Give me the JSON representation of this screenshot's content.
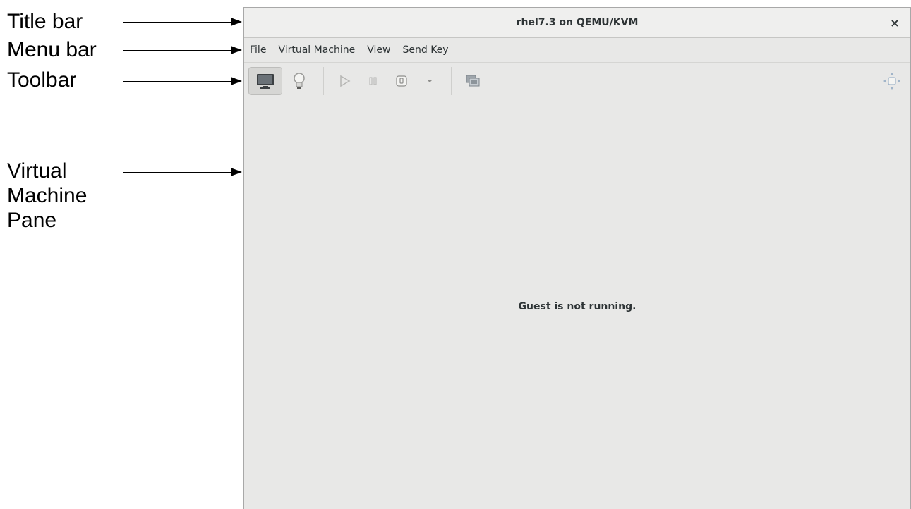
{
  "annotations": {
    "title_bar": "Title bar",
    "menu_bar": "Menu bar",
    "toolbar": "Toolbar",
    "vm_pane_line1": "Virtual",
    "vm_pane_line2": "Machine",
    "vm_pane_line3": "Pane"
  },
  "window": {
    "title": "rhel7.3 on QEMU/KVM",
    "close_glyph": "×"
  },
  "menubar": {
    "items": [
      "File",
      "Virtual Machine",
      "View",
      "Send Key"
    ]
  },
  "toolbar": {
    "icons": [
      "monitor-icon",
      "lightbulb-icon",
      "play-icon",
      "pause-icon",
      "power-icon",
      "dropdown-arrow-icon",
      "screens-icon",
      "fullscreen-move-icon"
    ]
  },
  "pane": {
    "message": "Guest is not running."
  }
}
